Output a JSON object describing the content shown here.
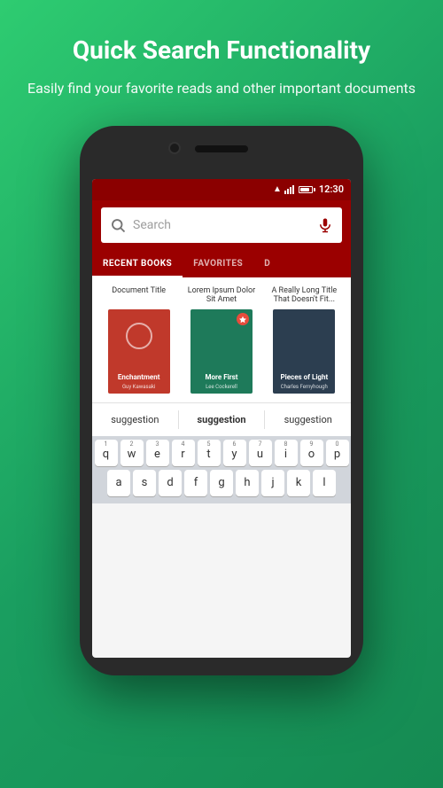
{
  "header": {
    "title": "Quick Search Functionality",
    "subtitle": "Easily find your favorite reads and other important documents"
  },
  "search": {
    "placeholder": "Search",
    "value": ""
  },
  "tabs": [
    {
      "label": "RECENT BOOKS",
      "active": true
    },
    {
      "label": "FAVORITES",
      "active": false
    },
    {
      "label": "D",
      "active": false
    }
  ],
  "books": [
    {
      "title": "Document Title",
      "author": "Guy Kawasaki",
      "book_title": "Enchantment",
      "color": "red"
    },
    {
      "title": "Lorem Ipsum Dolor Sit Amet",
      "author": "Lee Cockerell",
      "book_title": "More First",
      "color": "green"
    },
    {
      "title": "A Really Long Title That Doesn't Fit...",
      "author": "Charles Fernyhough",
      "book_title": "Pieces of Light",
      "color": "dark"
    }
  ],
  "suggestions": [
    {
      "label": "suggestion",
      "bold": false
    },
    {
      "label": "suggestion",
      "bold": true
    },
    {
      "label": "suggestion",
      "bold": false
    }
  ],
  "keyboard": {
    "row1": [
      {
        "num": "1",
        "letter": "q"
      },
      {
        "num": "2",
        "letter": "w"
      },
      {
        "num": "3",
        "letter": "e"
      },
      {
        "num": "4",
        "letter": "r"
      },
      {
        "num": "5",
        "letter": "t"
      },
      {
        "num": "6",
        "letter": "y"
      },
      {
        "num": "7",
        "letter": "u"
      },
      {
        "num": "8",
        "letter": "i"
      },
      {
        "num": "9",
        "letter": "o"
      },
      {
        "num": "0",
        "letter": "p"
      }
    ],
    "row2": [
      {
        "letter": "a"
      },
      {
        "letter": "s"
      },
      {
        "letter": "d"
      },
      {
        "letter": "f"
      },
      {
        "letter": "g"
      },
      {
        "letter": "h"
      },
      {
        "letter": "j"
      },
      {
        "letter": "k"
      },
      {
        "letter": "l"
      }
    ]
  },
  "status_bar": {
    "time": "12:30"
  },
  "colors": {
    "app_bar": "#9b0000",
    "background_gradient_top": "#2ecc71",
    "background_gradient_bottom": "#158a52"
  }
}
